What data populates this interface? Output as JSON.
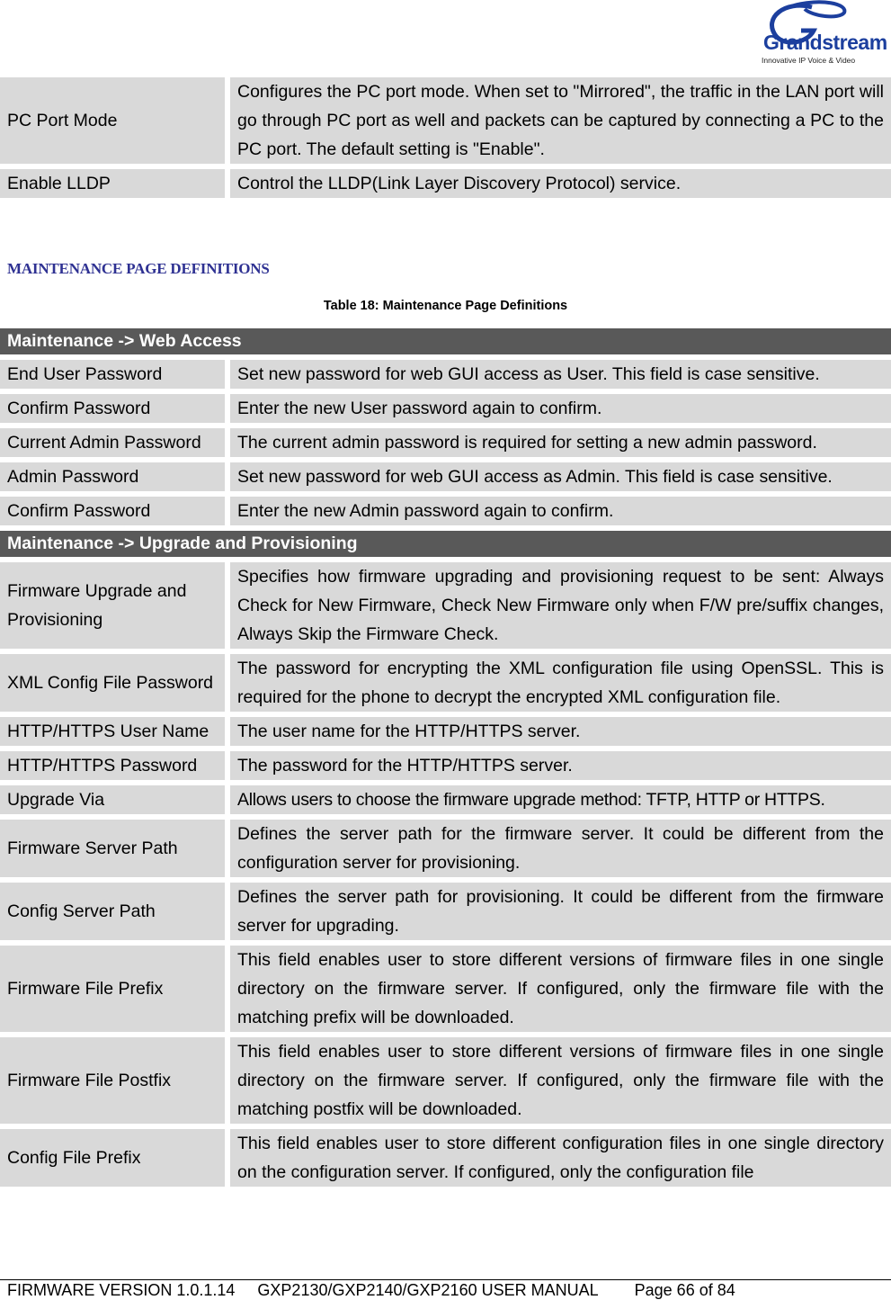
{
  "logo": {
    "brand": "Grandstream",
    "tagline": "Innovative IP Voice & Video",
    "color": "#1c3f9e"
  },
  "top_table": {
    "rows": [
      {
        "key": "PC Port Mode",
        "value": "Configures the PC port mode. When set to \"Mirrored\", the traffic in the LAN port will go through PC port as well and packets can be captured by connecting a PC to the PC port. The default setting is \"Enable\"."
      },
      {
        "key": "Enable LLDP",
        "value": "Control the LLDP(Link Layer Discovery Protocol) service."
      }
    ]
  },
  "section_heading": "MAINTENANCE PAGE DEFINITIONS",
  "table_caption": "Table 18: Maintenance Page Definitions",
  "maintenance_table": {
    "sections": [
      {
        "title": "Maintenance -> Web Access",
        "rows": [
          {
            "key": "End User Password",
            "value": "Set new password for web GUI access as User. This field is case sensitive."
          },
          {
            "key": "Confirm Password",
            "value": "Enter the new User password again to confirm."
          },
          {
            "key": "Current Admin Password",
            "value": "The current admin password is required for setting a new admin password."
          },
          {
            "key": "Admin Password",
            "value": "Set new password for web GUI access as Admin. This field is case sensitive."
          },
          {
            "key": "Confirm Password",
            "value": "Enter the new Admin password again to confirm."
          }
        ]
      },
      {
        "title": "Maintenance -> Upgrade and Provisioning",
        "rows": [
          {
            "key": "Firmware Upgrade and Provisioning",
            "value": "Specifies how firmware upgrading and provisioning request to be sent: Always Check for New Firmware, Check New Firmware only when F/W pre/suffix changes, Always Skip the Firmware Check."
          },
          {
            "key": "XML Config File Password",
            "value": "The password for encrypting the XML configuration file using OpenSSL. This is required for the phone to decrypt the encrypted XML configuration file."
          },
          {
            "key": "HTTP/HTTPS User Name",
            "value": "The user name for the HTTP/HTTPS server."
          },
          {
            "key": "HTTP/HTTPS Password",
            "value": "The password for the HTTP/HTTPS server."
          },
          {
            "key": "Upgrade Via",
            "value": "Allows users to choose the firmware upgrade method: TFTP, HTTP or HTTPS."
          },
          {
            "key": "Firmware Server Path",
            "value": "Defines the server path for the firmware server. It could be different from the configuration server for provisioning."
          },
          {
            "key": "Config Server Path",
            "value": "Defines the server path for provisioning. It could be different from the firmware server for upgrading."
          },
          {
            "key": "Firmware File Prefix",
            "value": "This field enables user to store different versions of firmware files in one single directory on the firmware server. If configured, only the firmware file with the matching prefix will be downloaded."
          },
          {
            "key": "Firmware File Postfix",
            "value": "This field enables user to store different versions of firmware files in one single directory on the firmware server. If configured, only the firmware file with the matching postfix will be downloaded."
          },
          {
            "key": "Config File Prefix",
            "value": "This field enables user to store different configuration files in one single directory on the configuration server. If configured, only the configuration file"
          }
        ]
      }
    ]
  },
  "footer": {
    "firmware": "FIRMWARE VERSION 1.0.1.14",
    "manual": "GXP2130/GXP2140/GXP2160 USER MANUAL",
    "page": "Page 66 of 84"
  }
}
